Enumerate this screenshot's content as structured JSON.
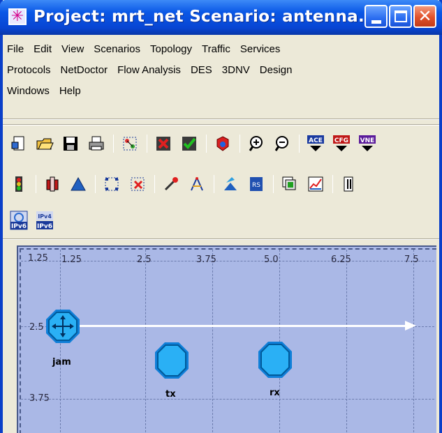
{
  "window": {
    "title": "Project: mrt_net Scenario: antenna...",
    "app_icon": "asterisk-app-icon",
    "close_glyph": "✕"
  },
  "menu": {
    "row1": [
      "File",
      "Edit",
      "View",
      "Scenarios",
      "Topology",
      "Traffic",
      "Services"
    ],
    "row2": [
      "Protocols",
      "NetDoctor",
      "Flow Analysis",
      "DES",
      "3DNV",
      "Design"
    ],
    "row3": [
      "Windows",
      "Help"
    ]
  },
  "toolbar1": {
    "tools": [
      "new-project-icon",
      "open-folder-icon",
      "save-icon",
      "print-icon",
      "rapid-config-icon",
      "fail-node-icon",
      "recover-node-icon",
      "run-simulation-icon",
      "zoom-in-icon",
      "zoom-out-icon"
    ],
    "ace_label": "ACE",
    "cfg_label": "CFG",
    "vne_label": "VNE"
  },
  "toolbar2": {
    "tools": [
      "traffic-light-icon",
      "device-config-icon",
      "triangle-icon",
      "selection-grid-icon",
      "selection-remove-icon",
      "drag-tool-icon",
      "compass-icon",
      "wizard-icon",
      "rs-label-icon",
      "layers-icon",
      "chart-icon",
      "document-icon"
    ],
    "rs_label": "RS"
  },
  "toolbar3": {
    "ipv6_label": "IPv6",
    "ipv4_label": "IPv4",
    "ipv6b_label": "IPv6"
  },
  "canvas": {
    "corner_label": "1.25",
    "x_ticks": [
      "1.25",
      "2.5",
      "3.75",
      "5.0",
      "6.25",
      "7.5"
    ],
    "y_ticks": [
      "2.5",
      "3.75"
    ],
    "nodes": [
      {
        "name": "jam",
        "icon": "jammer-node-icon"
      },
      {
        "name": "tx",
        "icon": "transmitter-node-icon"
      },
      {
        "name": "rx",
        "icon": "receiver-node-icon"
      }
    ],
    "background_color": "#aab8e6",
    "node_color": "#1aa0f0"
  }
}
